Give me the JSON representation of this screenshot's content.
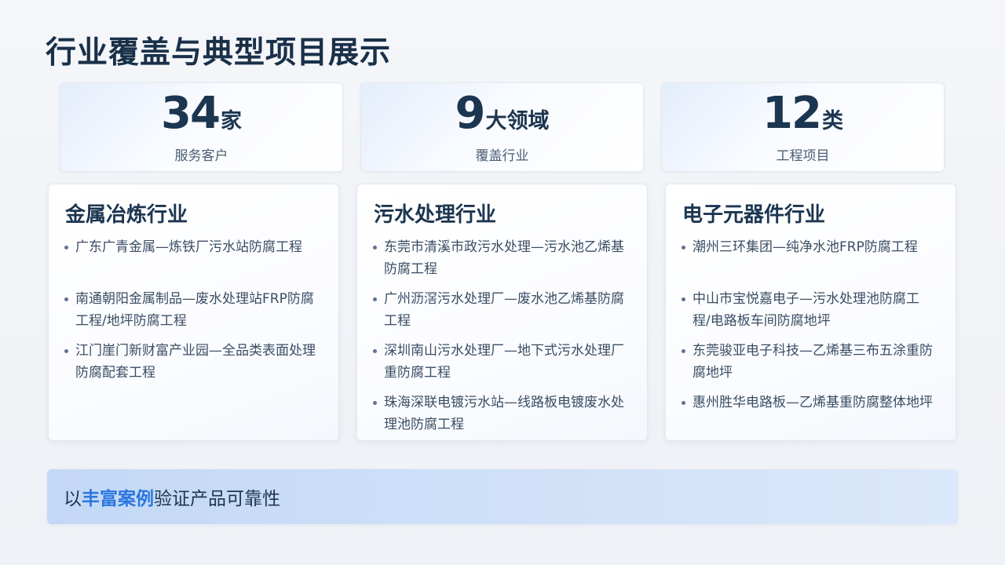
{
  "title": "行业覆盖与典型项目展示",
  "stats": [
    {
      "num": "34",
      "unit": "家",
      "label": "服务客户"
    },
    {
      "num": "9",
      "unit": "大领域",
      "label": "覆盖行业"
    },
    {
      "num": "12",
      "unit": "类",
      "label": "工程项目"
    }
  ],
  "cards": [
    {
      "title": "金属冶炼行业",
      "items": [
        "广东广青金属—炼铁厂污水站防腐工程",
        "南通朝阳金属制品—废水处理站FRP防腐工程/地坪防腐工程",
        "江门崖门新财富产业园—全品类表面处理防腐配套工程"
      ]
    },
    {
      "title": "污水处理行业",
      "items": [
        "东莞市清溪市政污水处理—污水池乙烯基防腐工程",
        "广州沥滘污水处理厂—废水池乙烯基防腐工程",
        "深圳南山污水处理厂—地下式污水处理厂重防腐工程",
        "珠海深联电镀污水站—线路板电镀废水处理池防腐工程"
      ]
    },
    {
      "title": "电子元器件行业",
      "items": [
        "潮州三环集团—纯净水池FRP防腐工程",
        "中山市宝悦嘉电子—污水处理池防腐工程/电路板车间防腐地坪",
        "东莞骏亚电子科技—乙烯基三布五涂重防腐地坪",
        "惠州胜华电路板—乙烯基重防腐整体地坪"
      ]
    }
  ],
  "banner": {
    "prefix": "以",
    "highlight": "丰富案例",
    "suffix": "验证产品可靠性"
  },
  "colors": {
    "accent": "#2a76e0",
    "title": "#1a3049"
  }
}
